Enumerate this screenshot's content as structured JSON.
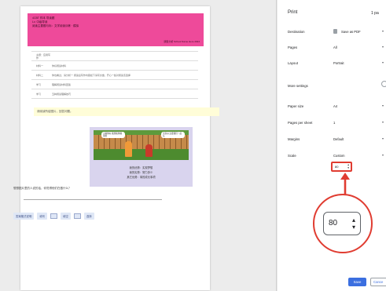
{
  "preview": {
    "banner_lines": [
      "4CBT 样本 导读题",
      "Lv. 中级导读",
      "阅读主要题与标：文学阅读训练 · 模拟"
    ],
    "banner_footer": "题型分析 School Name Here 2024",
    "table_rows": [
      {
        "key": "主题：应用写作",
        "val": ""
      },
      {
        "key": "材料一",
        "val": "你好阅读材料"
      },
      {
        "key": "材料二",
        "val": "你也看过，请分析一 阅读后写作内容如下请写文章，开心一些对阅读该选择"
      },
      {
        "key": "学习",
        "val": "理解阅读材料回答"
      },
      {
        "key": "学习",
        "val": "五种阅读理解技巧"
      }
    ],
    "highlight_text": "请阅读所给图片，回答问题。",
    "illustration": {
      "bubble1": "小猫你好 我想和你做朋友",
      "bubble2": "大家好 还要我们一起玩",
      "lines": [
        "我的优势：实现梦想",
        "我的劣势：努力多少",
        "其它优势：事的成长事项"
      ]
    },
    "question_text": "想想图片里的人说的话，你觉得他们在做什么？",
    "answer_row": [
      "答案格式说明",
      "填写",
      "填空",
      "选择"
    ]
  },
  "panel": {
    "title": "Print",
    "sheet_count": "1 pa",
    "destination": {
      "label": "Destination",
      "value": "Save as PDF"
    },
    "pages": {
      "label": "Pages",
      "value": "All"
    },
    "layout": {
      "label": "Layout",
      "value": "Portrait"
    },
    "more_settings": {
      "label": "More settings"
    },
    "paper_size": {
      "label": "Paper size",
      "value": "A4"
    },
    "pages_per_sheet": {
      "label": "Pages per sheet",
      "value": "1"
    },
    "margins": {
      "label": "Margins",
      "value": "Default"
    },
    "scale": {
      "label": "Scale",
      "value": "Custom",
      "input": "80"
    },
    "zoom_callout_value": "80",
    "save_label": "Save",
    "cancel_label": "Cance"
  },
  "colors": {
    "accent": "#e03c31",
    "save": "#3b6fe0",
    "banner": "#ee4a9a"
  }
}
